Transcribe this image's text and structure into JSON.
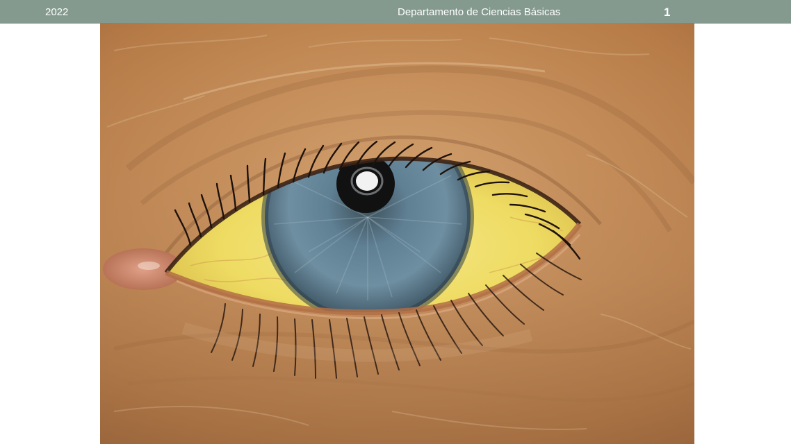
{
  "header": {
    "year": "2022",
    "department": "Departamento de Ciencias Básicas",
    "page_number": "1"
  },
  "photo": {
    "subject": "eye-photo"
  },
  "colors": {
    "header_bar": "#849a8f",
    "header_text": "#ffffff",
    "skin": "#c9955f",
    "sclera": "#f0dc6a",
    "iris": "#5f7f93",
    "pupil": "#111111"
  }
}
